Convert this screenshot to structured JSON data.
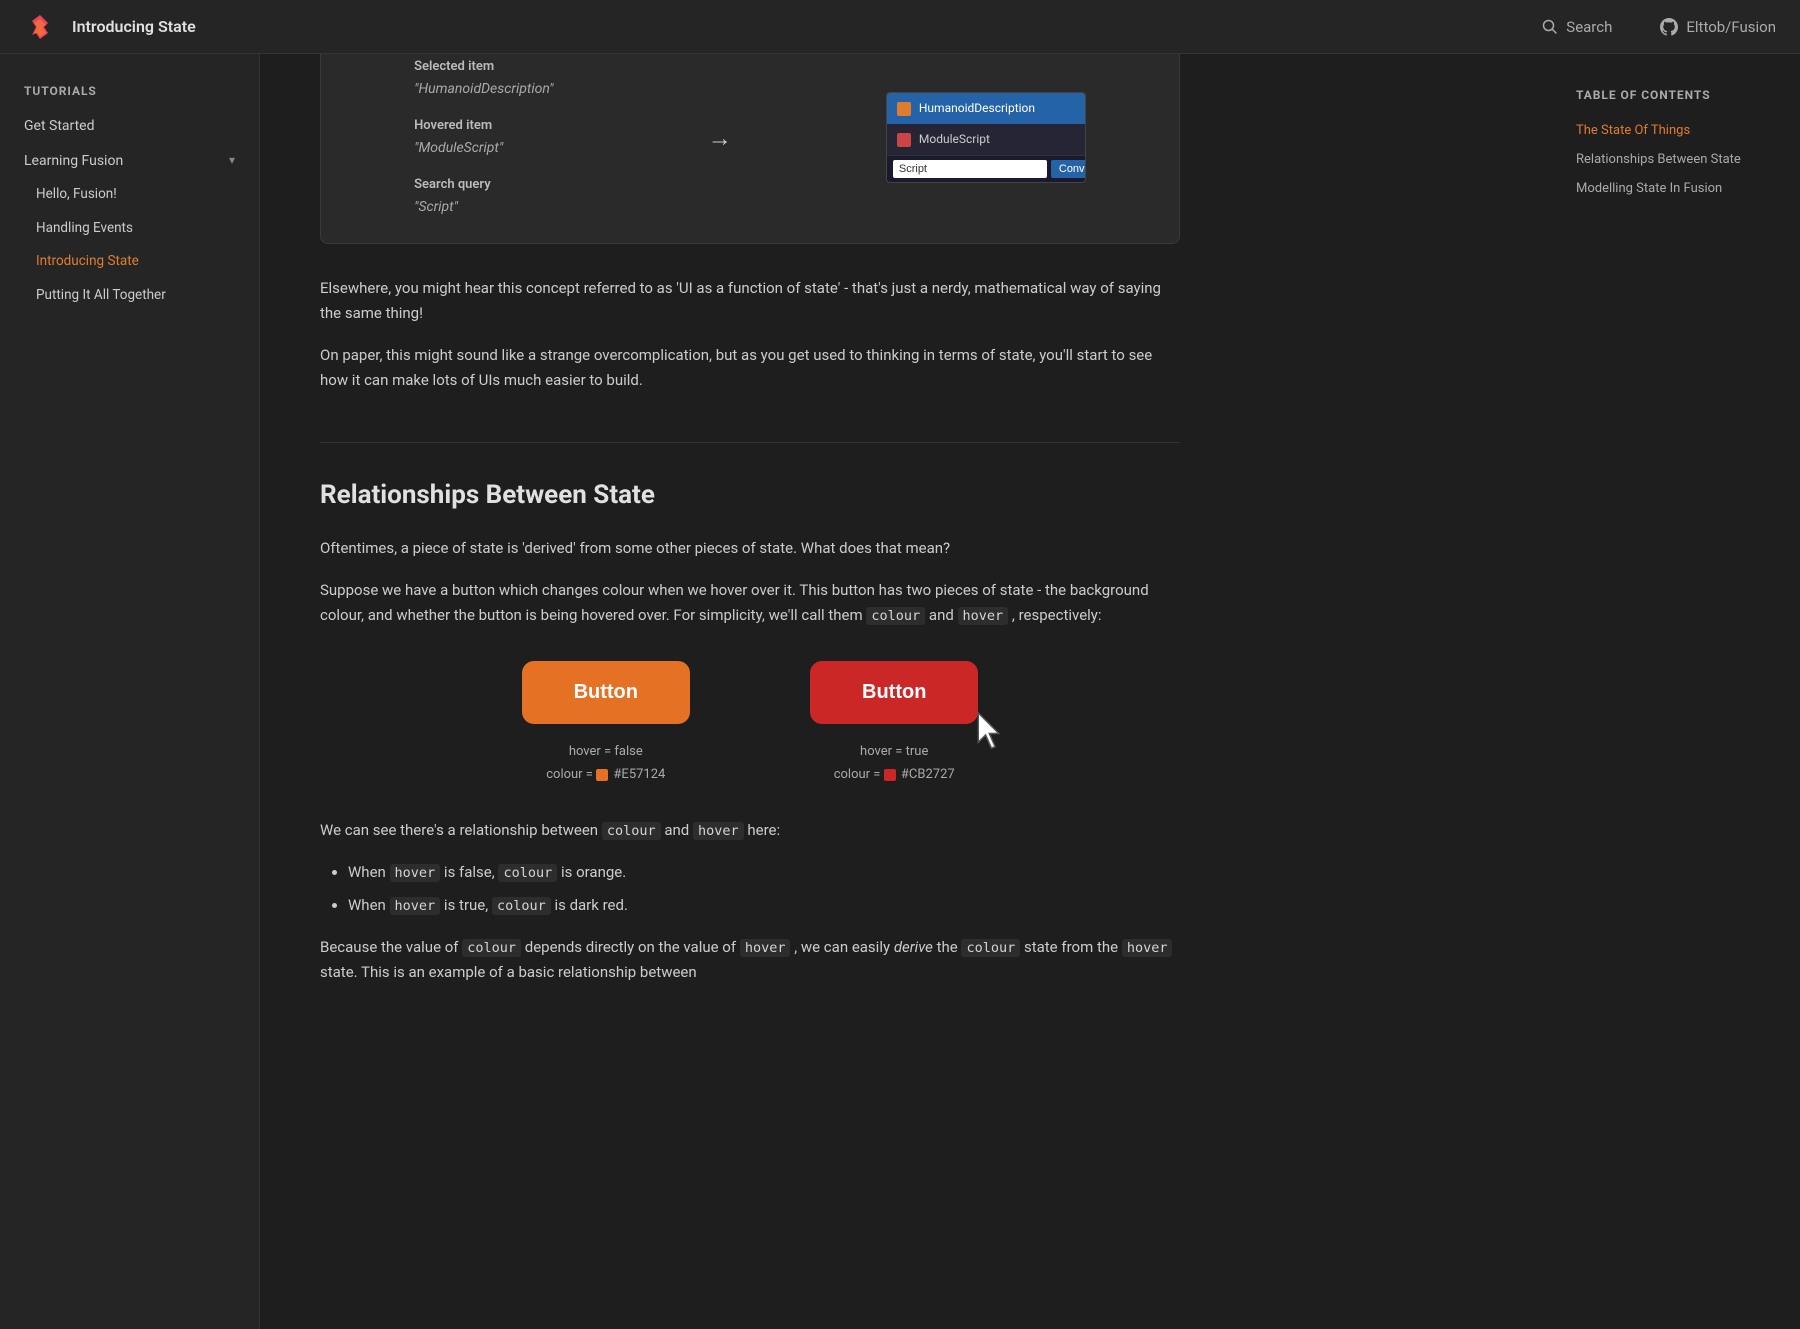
{
  "header": {
    "title": "Introducing State",
    "search_label": "Search",
    "github_label": "Elttob/Fusion"
  },
  "sidebar": {
    "tutorials_label": "Tutorials",
    "get_started_label": "Get Started",
    "learning_fusion_label": "Learning Fusion",
    "sub_items": [
      {
        "label": "Hello, Fusion!"
      },
      {
        "label": "Handling Events"
      },
      {
        "label": "Introducing State",
        "active": true
      },
      {
        "label": "Putting It All Together"
      }
    ]
  },
  "toc": {
    "title": "Table of contents",
    "items": [
      {
        "label": "The State Of Things",
        "active": true
      },
      {
        "label": "Relationships Between State",
        "active": false
      },
      {
        "label": "Modelling State In Fusion",
        "active": false
      }
    ]
  },
  "demo": {
    "selected_label": "Selected item",
    "selected_value": "\"HumanoidDescription\"",
    "hovered_label": "Hovered item",
    "hovered_value": "\"ModuleScript\"",
    "search_label": "Search query",
    "search_value": "\"Script\"",
    "convert_btn": "Convert",
    "roblox_rows": [
      {
        "label": "HumanoidDescription",
        "selected": true
      },
      {
        "label": "ModuleScript",
        "selected": false
      }
    ],
    "search_input_value": "Script"
  },
  "content": {
    "para1": "Elsewhere, you might hear this concept referred to as 'UI as a function of state' - that's just a nerdy, mathematical way of saying the same thing!",
    "para2": "On paper, this might sound like a strange overcomplication, but as you get used to thinking in terms of state, you'll start to see how it can make lots of UIs much easier to build.",
    "section_heading": "Relationships Between State",
    "para3": "Oftentimes, a piece of state is 'derived' from some other pieces of state. What does that mean?",
    "para4_pre": "Suppose we have a button which changes colour when we hover over it. This button has two pieces of state - the background colour, and whether the button is being hovered over. For simplicity, we'll call them",
    "code_colour": "colour",
    "para4_and": "and",
    "code_hover": "hover",
    "para4_post": ", respectively:",
    "btn_label": "Button",
    "hover_false_label": "hover = false",
    "hover_false_colour_label": "colour =",
    "hover_false_colour_value": "#E57124",
    "hover_true_label": "hover = true",
    "hover_true_colour_label": "colour =",
    "hover_true_colour_value": "#CB2727",
    "para5_pre": "We can see there's a relationship between",
    "code_colour2": "colour",
    "para5_and": "and",
    "code_hover2": "hover",
    "para5_post": "here:",
    "bullet1_pre": "When",
    "bullet1_code": "hover",
    "bullet1_mid": "is false,",
    "bullet1_code2": "colour",
    "bullet1_post": "is orange.",
    "bullet2_pre": "When",
    "bullet2_code": "hover",
    "bullet2_mid": "is true,",
    "bullet2_code2": "colour",
    "bullet2_post": "is dark red.",
    "para6_pre": "Because the value of",
    "code_colour3": "colour",
    "para6_mid": "depends directly on the value of",
    "code_hover3": "hover",
    "para6_cont": ", we can easily",
    "em_derive": "derive",
    "para6_post": "the",
    "code_colour4": "colour",
    "para6_end": "state from the",
    "code_hover4": "hover",
    "para6_final": "state. This is an example of a basic relationship between"
  }
}
